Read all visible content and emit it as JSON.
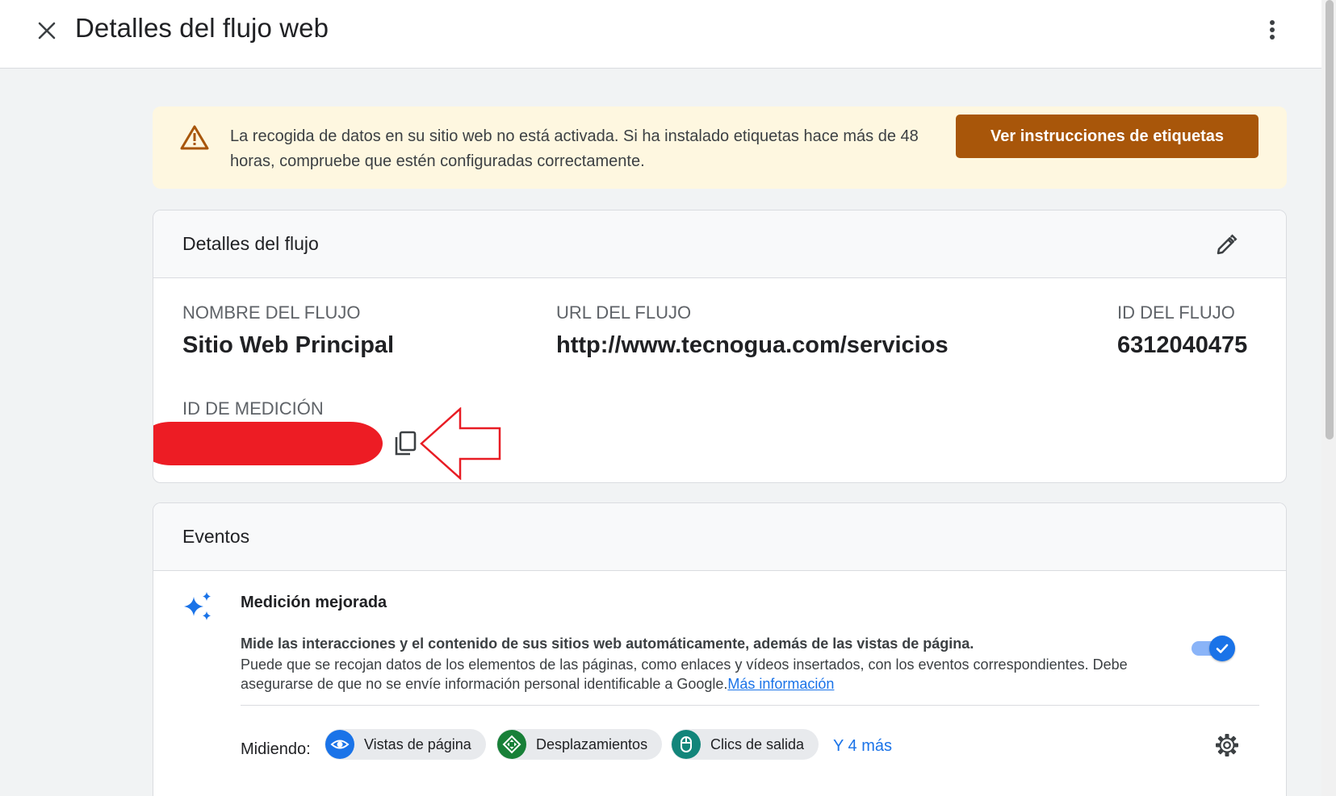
{
  "header": {
    "title": "Detalles del flujo web",
    "close_icon": "close-icon",
    "menu_icon": "more-vert-icon"
  },
  "banner": {
    "text": "La recogida de datos en su sitio web no está activada. Si ha instalado etiquetas hace más de 48 horas, compruebe que estén configuradas correctamente.",
    "button_label": "Ver instrucciones de etiquetas",
    "icon": "warning-icon",
    "colors": {
      "background": "#fef7e0",
      "button": "#a8560a"
    }
  },
  "stream_details": {
    "title": "Detalles del flujo",
    "edit_icon": "pencil-icon",
    "fields": {
      "name": {
        "label": "NOMBRE DEL FLUJO",
        "value": "Sitio Web Principal"
      },
      "url": {
        "label": "URL DEL FLUJO",
        "value": "http://www.tecnogua.com/servicios"
      },
      "id": {
        "label": "ID DEL FLUJO",
        "value": "6312040475"
      },
      "measurement_id": {
        "label": "ID DE MEDICIÓN"
      }
    },
    "copy_icon": "copy-icon"
  },
  "events": {
    "title": "Eventos",
    "enhanced_measurement": {
      "title": "Medición mejorada",
      "description_bold": "Mide las interacciones y el contenido de sus sitios web automáticamente, además de las vistas de página.",
      "description": "Puede que se recojan datos de los elementos de las páginas, como enlaces y vídeos insertados, con los eventos correspondientes. Debe asegurarse de que no se envíe información personal identificable a Google.",
      "link": "Más información",
      "enabled": true
    },
    "measuring": {
      "label": "Midiendo:",
      "chips": [
        {
          "label": "Vistas de página",
          "icon": "eye-icon",
          "color": "#1a73e8"
        },
        {
          "label": "Desplazamientos",
          "icon": "scroll-icon",
          "color": "#188038"
        },
        {
          "label": "Clics de salida",
          "icon": "mouse-icon",
          "color": "#12857a"
        }
      ],
      "more": "Y 4 más"
    }
  }
}
